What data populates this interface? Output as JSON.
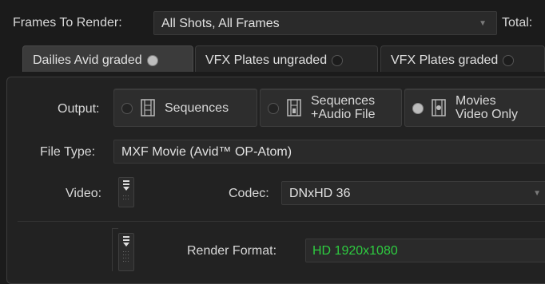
{
  "frames": {
    "label": "Frames To Render:",
    "value": "All Shots, All Frames",
    "total_label": "Total:"
  },
  "tabs": [
    {
      "label": "Dailies Avid graded",
      "active": true
    },
    {
      "label": "VFX Plates ungraded",
      "active": false
    },
    {
      "label": "VFX Plates graded",
      "active": false
    }
  ],
  "output": {
    "label": "Output:",
    "options": [
      {
        "label": "Sequences",
        "selected": false
      },
      {
        "label_line1": "Sequences",
        "label_line2": "+Audio File",
        "selected": false
      },
      {
        "label_line1": "Movies",
        "label_line2": "Video Only",
        "selected": true
      }
    ]
  },
  "file_type": {
    "label": "File Type:",
    "value": "MXF Movie (Avid™ OP-Atom)"
  },
  "video": {
    "label": "Video:",
    "codec_label": "Codec:",
    "codec_value": "DNxHD 36"
  },
  "render_format": {
    "label": "Render Format:",
    "value": "HD 1920x1080",
    "value_color": "#2ecc40"
  },
  "icons": [
    "film-strip-icon",
    "film-audio-icon",
    "movie-icon",
    "dropdown-arrow-icon",
    "toggle-handle-icon"
  ]
}
